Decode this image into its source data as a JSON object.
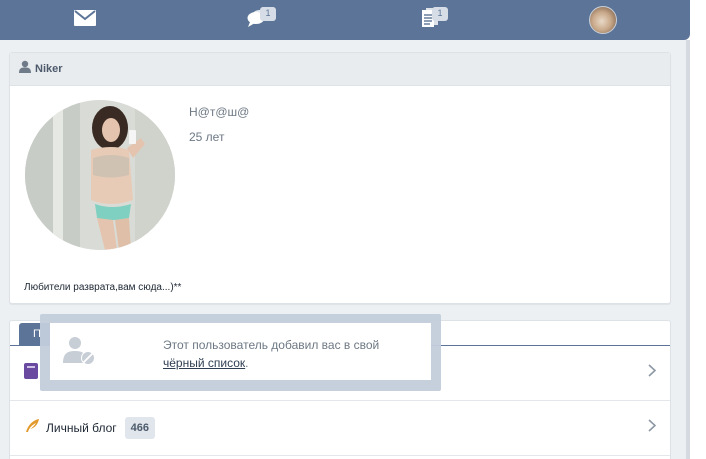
{
  "topbar": {
    "mail_icon": "envelope-icon",
    "messages_icon": "chat-bubbles-icon",
    "messages_badge": "1",
    "notifications_icon": "documents-icon",
    "notifications_badge": "1",
    "avatar": "user-avatar"
  },
  "profile": {
    "login": "Niker",
    "name": "Н@т@ш@",
    "age": "25 лет",
    "status": "Любители разврата,вам сюда...)**"
  },
  "tabs": {
    "active_label": "П"
  },
  "rows": [
    {
      "label": "",
      "count": ""
    },
    {
      "label": "Личный блог",
      "count": "466"
    }
  ],
  "notice": {
    "text_before": "Этот пользователь добавил вас в свой",
    "link_text": "чёрный список",
    "text_after": "."
  },
  "colors": {
    "topbar": "#5b7497",
    "background": "#edf0f3",
    "accent": "#5b7497"
  }
}
